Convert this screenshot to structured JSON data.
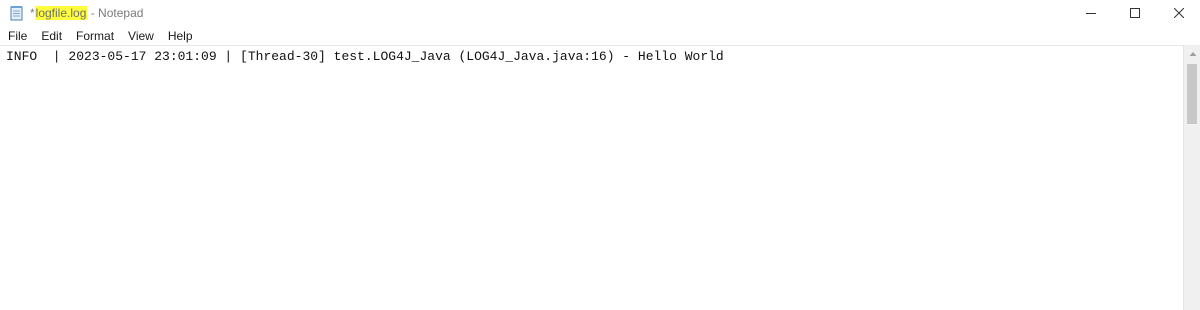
{
  "window": {
    "title_modified_marker": "*",
    "title_filename": "logfile.log",
    "title_separator": " - ",
    "title_app": "Notepad",
    "controls": {
      "minimize_icon": "minimize-icon",
      "maximize_icon": "maximize-icon",
      "close_icon": "close-icon"
    }
  },
  "menu": {
    "items": [
      {
        "label": "File"
      },
      {
        "label": "Edit"
      },
      {
        "label": "Format"
      },
      {
        "label": "View"
      },
      {
        "label": "Help"
      }
    ]
  },
  "editor": {
    "content": "INFO  | 2023-05-17 23:01:09 | [Thread-30] test.LOG4J_Java (LOG4J_Java.java:16) - Hello World"
  },
  "colors": {
    "highlight": "#ffff3c",
    "title_text": "#7a7a7a",
    "background": "#ffffff"
  }
}
